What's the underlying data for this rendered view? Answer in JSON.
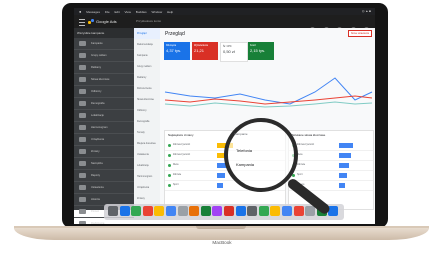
{
  "menubar": {
    "apple": "",
    "items": [
      "Messages",
      "File",
      "Edit",
      "View",
      "Buddies",
      "Window",
      "Help"
    ],
    "right": ""
  },
  "appbar": {
    "brand": "Google Ads",
    "account": "Przykładowe konto"
  },
  "sidebar": {
    "header": "Wszystkie kampanie",
    "items": [
      "Kampanie",
      "Grupy reklam",
      "Reklamy",
      "Słowa kluczowe",
      "Odbiorcy",
      "Demografia",
      "Lokalizacje",
      "Harmonogram",
      "Urządzenia",
      "Zmiany",
      "Narzędzia",
      "Raporty",
      "Ustawienia",
      "Historia",
      "Pomoc",
      "Rozliczenia"
    ]
  },
  "subnav": {
    "items": [
      "Przegląd",
      "Rekomendacje",
      "Kampanie",
      "Grupy reklam",
      "Reklamy",
      "Rozszerzenia",
      "Słowa kluczowe",
      "Odbiorcy",
      "Demografia",
      "Tematy",
      "Miejsca docelowe",
      "Ustawienia",
      "Lokalizacje",
      "Harmonogram",
      "Urządzenia",
      "Zmiany"
    ],
    "active_index": 0
  },
  "main": {
    "title": "Przegląd",
    "alert": "Nowe ustawienia",
    "cards": [
      {
        "label": "Kliknięcia",
        "value": "4,37 tys.",
        "color": "#1a73e8"
      },
      {
        "label": "Wyświetlenia",
        "value": "21,21",
        "color": "#d93025"
      },
      {
        "label": "Śr. CPC",
        "value": "0,50 zł",
        "color": "#ffffff"
      },
      {
        "label": "Koszt",
        "value": "2,15 tys.",
        "color": "#188038"
      }
    ]
  },
  "panels": {
    "left": {
      "title": "Największe zmiany",
      "rows": [
        "Zdrowa żywność",
        "Zdrowa żywność",
        "Dieta",
        "Zdrowie",
        "Sport"
      ]
    },
    "right": {
      "title": "Szukane słowa kluczowe",
      "rows": [
        "Zdrowa żywność",
        "Dieta",
        "Zdrowie",
        "Sport",
        "Fitness"
      ]
    }
  },
  "lens": {
    "caption": "Kampanie",
    "rows": [
      "Telefonia",
      "Kampania"
    ]
  },
  "laptop": {
    "label": "MacBook"
  }
}
